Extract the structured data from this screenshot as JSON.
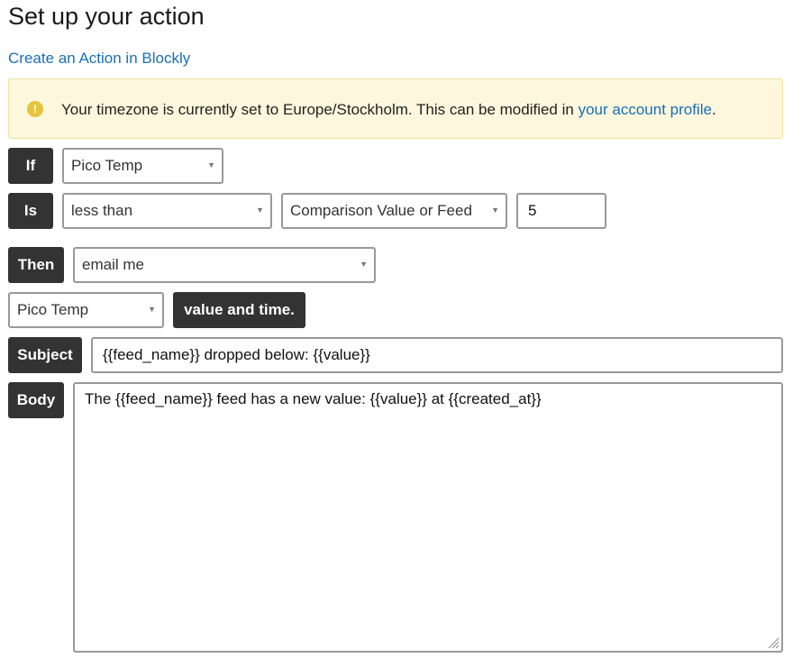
{
  "page": {
    "title": "Set up your action",
    "blockly_link": "Create an Action in Blockly"
  },
  "alert": {
    "icon": "warning-icon",
    "icon_glyph": "!",
    "text_before": "Your timezone is currently set to Europe/Stockholm. This can be modified in ",
    "link_text": "your account profile",
    "text_after": "."
  },
  "form": {
    "if_label": "If",
    "if_feed": "Pico Temp",
    "is_label": "Is",
    "operator": "less than",
    "comparison_type": "Comparison Value or Feed",
    "comparison_value": "5",
    "then_label": "Then",
    "action": "email me",
    "value_feed": "Pico Temp",
    "value_and_time_label": "value and time.",
    "subject_label": "Subject",
    "subject_value": "{{feed_name}} dropped below: {{value}}",
    "body_label": "Body",
    "body_value": "The {{feed_name}} feed has a new value: {{value}} at {{created_at}}"
  },
  "colors": {
    "link": "#1a6fb8",
    "label_bg": "#333333",
    "alert_bg": "#fcf7dd",
    "alert_icon": "#e7c43a"
  }
}
